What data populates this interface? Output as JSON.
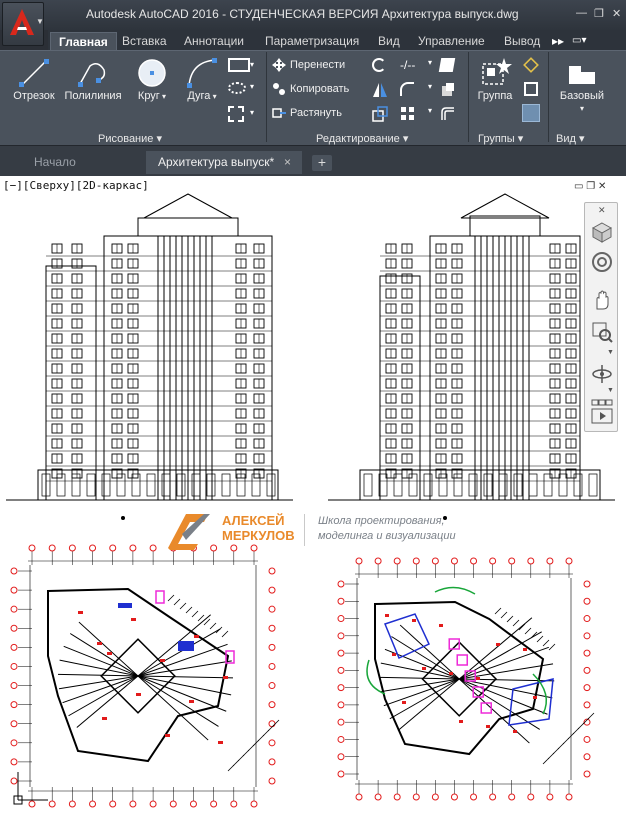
{
  "titlebar": {
    "title": "Autodesk AutoCAD 2016 - СТУДЕНЧЕСКАЯ ВЕРСИЯ    Архитектура выпуск.dwg",
    "minimize": "—",
    "restore": "❐",
    "close": "✕"
  },
  "ribbon_tabs": [
    "Главная",
    "Вставка",
    "Аннотации",
    "Параметризация",
    "Вид",
    "Управление",
    "Вывод"
  ],
  "ribbon": {
    "draw": {
      "line": "Отрезок",
      "polyline": "Полилиния",
      "circle": "Круг",
      "arc": "Дуга",
      "panel_label": "Рисование ▾"
    },
    "modify": {
      "move": "Перенести",
      "copy": "Копировать",
      "stretch": "Растянуть",
      "panel_label": "Редактирование ▾"
    },
    "groups": {
      "group": "Группа",
      "panel_label": "Группы ▾"
    },
    "view": {
      "base": "Базовый",
      "panel_label": "Вид ▾"
    }
  },
  "doc_tabs": {
    "start": "Начало",
    "active": "Архитектура выпуск*",
    "close": "×",
    "new": "+"
  },
  "viewport": {
    "label": "[−][Сверху][2D-каркас]"
  },
  "watermark": {
    "name_line1": "АЛЕКСЕЙ",
    "name_line2": "МЕРКУЛОВ",
    "desc_line1": "Школа проектирования,",
    "desc_line2": "моделинга и визуализации"
  },
  "colors": {
    "accent_red": "#d9281c",
    "ribbon_bg": "#4a525c",
    "brand_orange": "#e98a2b",
    "plan_red": "#e21b1b",
    "plan_magenta": "#ee2ad8",
    "plan_blue": "#1f2fd0",
    "plan_green": "#19a63a"
  }
}
